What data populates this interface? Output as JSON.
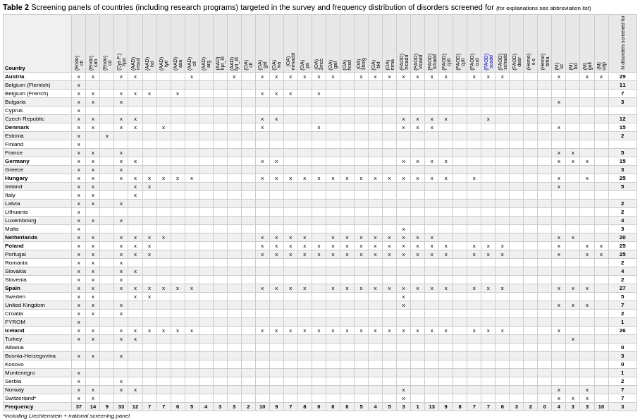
{
  "title": {
    "label": "Table 2",
    "description": "Screening panels of countries (including research programs) targeted in the survey and frequency distribution of disorders screened for",
    "note": "(for explanations see abbreviation list)"
  },
  "columns": {
    "country": "Country",
    "groups": [
      {
        "label": "(Endo)",
        "cols": [
          "ch"
        ]
      },
      {
        "label": "(Endo)",
        "cols": [
          "cah"
        ]
      },
      {
        "label": "(Endo)",
        "cols": [
          "cd"
        ]
      },
      {
        "label": "(Cys F.)",
        "cols": [
          "hpa"
        ]
      },
      {
        "label": "(AAD)",
        "cols": [
          "msud"
        ]
      },
      {
        "label": "(AAD)",
        "cols": [
          "hcl"
        ]
      },
      {
        "label": "(AAD)",
        "cols": [
          "tyrl"
        ]
      },
      {
        "label": "(AAD)",
        "cols": [
          "asa"
        ]
      },
      {
        "label": "(AAD)",
        "cols": [
          "cit"
        ]
      },
      {
        "label": "(AAD)",
        "cols": [
          "arg"
        ]
      },
      {
        "label": "(AAD)",
        "cols": [
          "hpt_III"
        ]
      },
      {
        "label": "(AAD)",
        "cols": [
          "tyrl_III"
        ]
      },
      {
        "label": "(OA)",
        "cols": [
          "clt"
        ]
      },
      {
        "label": "(OA)",
        "cols": [
          "gal"
        ]
      },
      {
        "label": "(OA)",
        "cols": [
          "iva"
        ]
      },
      {
        "label": "(OA)",
        "cols": [
          "mmacbl"
        ]
      },
      {
        "label": "(OA)",
        "cols": [
          "pa"
        ]
      },
      {
        "label": "(OA)",
        "cols": [
          "3mcc"
        ]
      },
      {
        "label": "(OA)",
        "cols": [
          "gall"
        ]
      },
      {
        "label": "(OA)",
        "cols": [
          "hcsd"
        ]
      },
      {
        "label": "(OA)",
        "cols": [
          "3hmg"
        ]
      },
      {
        "label": "(OA)",
        "cols": [
          "bkt"
        ]
      },
      {
        "label": "(OA)",
        "cols": [
          "mma"
        ]
      },
      {
        "label": "(FAOD)",
        "cols": [
          "mcadd"
        ]
      },
      {
        "label": "(FAOD)",
        "cols": [
          "vlcadd"
        ]
      },
      {
        "label": "(FAOD)",
        "cols": [
          "lchadd"
        ]
      },
      {
        "label": "(FAOD)",
        "cols": [
          "cptl"
        ]
      },
      {
        "label": "(FAOD)",
        "cols": [
          "cptl2"
        ]
      },
      {
        "label": "(FAOD)",
        "cols": [
          "cud"
        ]
      },
      {
        "label": "(FAOD)",
        "cols": [
          "scadd"
        ]
      },
      {
        "label": "(FAOD)",
        "cols": [
          "schadd"
        ]
      },
      {
        "label": "(FAOD)",
        "cols": [
          "deer"
        ]
      },
      {
        "label": "(Hemo)",
        "cols": [
          "s-s"
        ]
      },
      {
        "label": "(Hemo)",
        "cols": [
          "btha"
        ]
      },
      {
        "label": "(M)",
        "cols": [
          "sc"
        ]
      },
      {
        "label": "(M)",
        "cols": [
          "bio"
        ]
      },
      {
        "label": "(M)",
        "cols": [
          "galt"
        ]
      },
      {
        "label": "(M)",
        "cols": [
          "udp"
        ]
      },
      {
        "label": "N disorders screened for",
        "cols": [
          "n"
        ]
      }
    ],
    "abbrevs": [
      "ch",
      "cah",
      "cd",
      "hpa",
      "msud",
      "hcl",
      "tyrl",
      "asa",
      "cit",
      "arg",
      "hpt_III",
      "tyrl_III",
      "clt",
      "gal",
      "iva",
      "mmacbl",
      "pa",
      "3mcc",
      "gall",
      "hcsd",
      "3hmg",
      "bkt",
      "mma",
      "mcadd",
      "vlcadd",
      "lchadd",
      "cptl",
      "cptl2",
      "cud",
      "scadd",
      "schadd",
      "deer",
      "s-s",
      "btha",
      "sc",
      "bio",
      "galt",
      "udp",
      "n"
    ]
  },
  "rows": [
    {
      "country": "Austria",
      "bold": true,
      "cells": {
        "ch": "x",
        "cah": "x",
        "hpa": "x",
        "msud": "x",
        "cit": "x",
        "tyrl_III": "x",
        "gal": "x",
        "iva": "x",
        "mmacbl": "x",
        "pa": "x",
        "3mcc": "x",
        "gall": "x",
        "3hmg": "x",
        "bkt": "x",
        "mma": "x",
        "mcadd": "x",
        "vlcadd": "x",
        "lchadd": "x",
        "cptl": "x",
        "cud": "x",
        "scadd": "x",
        "schadd": "x",
        "sc": "x",
        "galt": "x",
        "udp": "x"
      },
      "n": "29"
    },
    {
      "country": "Belgium (Flemish)",
      "cells": {
        "ch": "x"
      },
      "n": "11"
    },
    {
      "country": "Belgium (French)",
      "cells": {
        "ch": "x",
        "cah": "x",
        "hpa": "x",
        "msud": "x",
        "hcl": "x",
        "asa": "x",
        "gal": "x",
        "iva": "x",
        "mmacbl": "x",
        "3mcc": "x"
      },
      "n": "7"
    },
    {
      "country": "Bulgaria",
      "cells": {
        "ch": "x",
        "cah": "x",
        "hpa": "x",
        "sc": "x"
      },
      "n": "3"
    },
    {
      "country": "Cyprus",
      "cells": {
        "ch": "x"
      },
      "n": ""
    },
    {
      "country": "Czech Republic",
      "cells": {
        "ch": "x",
        "cah": "x",
        "hpa": "x",
        "msud": "x",
        "gal": "x",
        "iva": "x",
        "mcadd": "x",
        "vlcadd": "x",
        "lchadd": "x",
        "cptl": "x",
        "scadd": "x"
      },
      "n": "12"
    },
    {
      "country": "Denmark",
      "bold": true,
      "cells": {
        "ch": "x",
        "cah": "x",
        "hpa": "x",
        "msud": "x",
        "tyrl": "x",
        "gal": "x",
        "3mcc": "x",
        "mcadd": "x",
        "vlcadd": "x",
        "lchadd": "x",
        "sc": "x"
      },
      "n": "15"
    },
    {
      "country": "Estonia",
      "cells": {
        "ch": "x",
        "cd": "x"
      },
      "n": "2"
    },
    {
      "country": "Finland",
      "cells": {
        "ch": "x"
      },
      "n": ""
    },
    {
      "country": "France",
      "cells": {
        "ch": "x",
        "cah": "x",
        "hpa": "x",
        "sc": "x",
        "bio": "x"
      },
      "n": "5"
    },
    {
      "country": "Germany",
      "bold": true,
      "cells": {
        "ch": "x",
        "cah": "x",
        "hpa": "x",
        "msud": "x",
        "gal": "x",
        "iva": "x",
        "mcadd": "x",
        "vlcadd": "x",
        "lchadd": "x",
        "cptl": "x",
        "sc": "x",
        "bio": "x",
        "galt": "x"
      },
      "n": "15"
    },
    {
      "country": "Greece",
      "cells": {
        "ch": "x",
        "cah": "x",
        "hpa": "x"
      },
      "n": "3"
    },
    {
      "country": "Hungary",
      "bold": true,
      "cells": {
        "ch": "x",
        "cah": "x",
        "hpa": "x",
        "msud": "x",
        "hcl": "x",
        "tyrl": "x",
        "asa": "x",
        "cit": "x",
        "gal": "x",
        "iva": "x",
        "mmacbl": "x",
        "pa": "x",
        "3mcc": "x",
        "gall": "x",
        "hcsd": "x",
        "3hmg": "x",
        "bkt": "x",
        "mma": "x",
        "mcadd": "x",
        "vlcadd": "x",
        "lchadd": "x",
        "cptl": "x",
        "cud": "x",
        "sc": "x",
        "galt": "x"
      },
      "n": "25"
    },
    {
      "country": "Ireland",
      "cells": {
        "ch": "x",
        "cah": "x",
        "msud": "x",
        "hcl": "x",
        "sc": "x"
      },
      "n": "5"
    },
    {
      "country": "Italy",
      "cells": {
        "ch": "x",
        "cah": "x",
        "msud": "x"
      },
      "n": ""
    },
    {
      "country": "Latvia",
      "cells": {
        "ch": "x",
        "cah": "x",
        "hpa": "x"
      },
      "n": "2"
    },
    {
      "country": "Lithuania",
      "cells": {
        "ch": "x"
      },
      "n": "2"
    },
    {
      "country": "Luxembourg",
      "cells": {
        "ch": "x",
        "cah": "x",
        "hpa": "x"
      },
      "n": "4"
    },
    {
      "country": "Malta",
      "cells": {
        "ch": "x",
        "mcadd": "x"
      },
      "n": "3"
    },
    {
      "country": "Netherlands",
      "bold": true,
      "cells": {
        "ch": "x",
        "cah": "x",
        "hpa": "x",
        "msud": "x",
        "hcl": "x",
        "tyrl": "x",
        "gal": "x",
        "iva": "x",
        "mmacbl": "x",
        "pa": "x",
        "gall": "x",
        "hcsd": "x",
        "3hmg": "x",
        "bkt": "x",
        "mma": "x",
        "mcadd": "x",
        "vlcadd": "x",
        "lchadd": "x",
        "sc": "x",
        "bio": "x"
      },
      "n": "20"
    },
    {
      "country": "Poland",
      "bold": true,
      "cells": {
        "ch": "x",
        "cah": "x",
        "hpa": "x",
        "msud": "x",
        "hcl": "x",
        "gal": "x",
        "iva": "x",
        "mmacbl": "x",
        "pa": "x",
        "3mcc": "x",
        "gall": "x",
        "hcsd": "x",
        "3hmg": "x",
        "bkt": "x",
        "mma": "x",
        "mcadd": "x",
        "vlcadd": "x",
        "lchadd": "x",
        "cptl": "x",
        "cud": "x",
        "scadd": "x",
        "schadd": "x",
        "sc": "x",
        "galt": "x",
        "udp": "x"
      },
      "n": "25"
    },
    {
      "country": "Portugal",
      "cells": {
        "ch": "x",
        "cah": "x",
        "hpa": "x",
        "msud": "x",
        "hcl": "x",
        "gal": "x",
        "iva": "x",
        "mmacbl": "x",
        "pa": "x",
        "3mcc": "x",
        "gall": "x",
        "hcsd": "x",
        "3hmg": "x",
        "bkt": "x",
        "mma": "x",
        "mcadd": "x",
        "vlcadd": "x",
        "lchadd": "x",
        "cptl": "x",
        "cud": "x",
        "scadd": "x",
        "schadd": "x",
        "sc": "x",
        "galt": "x",
        "udp": "x"
      },
      "n": "25"
    },
    {
      "country": "Romania",
      "cells": {
        "ch": "x",
        "cah": "x",
        "hpa": "x"
      },
      "n": "2"
    },
    {
      "country": "Slovakia",
      "cells": {
        "ch": "x",
        "cah": "x",
        "hpa": "x",
        "msud": "x"
      },
      "n": "4"
    },
    {
      "country": "Slovenia",
      "cells": {
        "ch": "x",
        "cah": "x",
        "hpa": "x"
      },
      "n": "2"
    },
    {
      "country": "Spain",
      "bold": true,
      "cells": {
        "ch": "x",
        "cah": "x",
        "hpa": "x",
        "msud": "x",
        "hcl": "x",
        "tyrl": "x",
        "asa": "x",
        "cit": "x",
        "gal": "x",
        "iva": "x",
        "mmacbl": "x",
        "pa": "x",
        "gall": "x",
        "hcsd": "x",
        "3hmg": "x",
        "bkt": "x",
        "mma": "x",
        "mcadd": "x",
        "vlcadd": "x",
        "lchadd": "x",
        "cptl": "x",
        "cud": "x",
        "scadd": "x",
        "schadd": "x",
        "sc": "x",
        "bio": "x",
        "galt": "x"
      },
      "n": "27"
    },
    {
      "country": "Sweden",
      "cells": {
        "ch": "x",
        "cah": "x",
        "msud": "x",
        "hcl": "x",
        "mcadd": "x"
      },
      "n": "5"
    },
    {
      "country": "United Kingdom",
      "cells": {
        "ch": "x",
        "cah": "x",
        "hpa": "x",
        "mcadd": "x",
        "sc": "x",
        "bio": "x",
        "galt": "x"
      },
      "n": "7"
    },
    {
      "country": "Croatia",
      "cells": {
        "ch": "x",
        "cah": "x",
        "hpa": "x"
      },
      "n": "2"
    },
    {
      "country": "FYROM",
      "cells": {
        "ch": "x"
      },
      "n": "1"
    },
    {
      "country": "Iceland",
      "bold": true,
      "cells": {
        "ch": "x",
        "cah": "x",
        "hpa": "x",
        "msud": "x",
        "hcl": "x",
        "tyrl": "x",
        "asa": "x",
        "cit": "x",
        "gal": "x",
        "iva": "x",
        "mmacbl": "x",
        "pa": "x",
        "3mcc": "x",
        "gall": "x",
        "hcsd": "x",
        "3hmg": "x",
        "bkt": "x",
        "mma": "x",
        "mcadd": "x",
        "vlcadd": "x",
        "lchadd": "x",
        "cptl": "x",
        "cud": "x",
        "scadd": "x",
        "schadd": "x",
        "sc": "x"
      },
      "n": "26"
    },
    {
      "country": "Turkey",
      "cells": {
        "ch": "x",
        "cah": "x",
        "hpa": "x",
        "msud": "x",
        "bio": "x"
      },
      "n": ""
    },
    {
      "country": "Albania",
      "cells": {},
      "n": "0"
    },
    {
      "country": "Bosnia-Herzegovina",
      "cells": {
        "ch": "x",
        "cah": "x",
        "hpa": "x"
      },
      "n": "3"
    },
    {
      "country": "Kosovo",
      "cells": {},
      "n": "0"
    },
    {
      "country": "Montenegro",
      "cells": {
        "ch": "x"
      },
      "n": "1"
    },
    {
      "country": "Serbia",
      "cells": {
        "ch": "x",
        "hpa": "x"
      },
      "n": "2"
    },
    {
      "country": "Norway",
      "cells": {
        "ch": "x",
        "cah": "x",
        "hpa": "x",
        "msud": "x",
        "mcadd": "x",
        "sc": "x",
        "galt": "x"
      },
      "n": "7"
    },
    {
      "country": "Switzerland*",
      "cells": {
        "ch": "x",
        "cah": "x",
        "mcadd": "x",
        "sc": "x",
        "bio": "x",
        "galt": "x"
      },
      "n": "7"
    }
  ],
  "frequency": {
    "label": "Frequency",
    "values": [
      "37",
      "14",
      "9",
      "33",
      "12",
      "7",
      "7",
      "6",
      "5",
      "4",
      "3",
      "3",
      "2",
      "10",
      "9",
      "7",
      "8",
      "6",
      "6",
      "6",
      "5",
      "4",
      "5",
      "3",
      "1",
      "13",
      "9",
      "8",
      "7",
      "7",
      "6",
      "3",
      "2",
      "0",
      "4",
      "3",
      "3",
      "10",
      "3"
    ]
  },
  "footnote": "*including Liechtenstein + national screening panel"
}
